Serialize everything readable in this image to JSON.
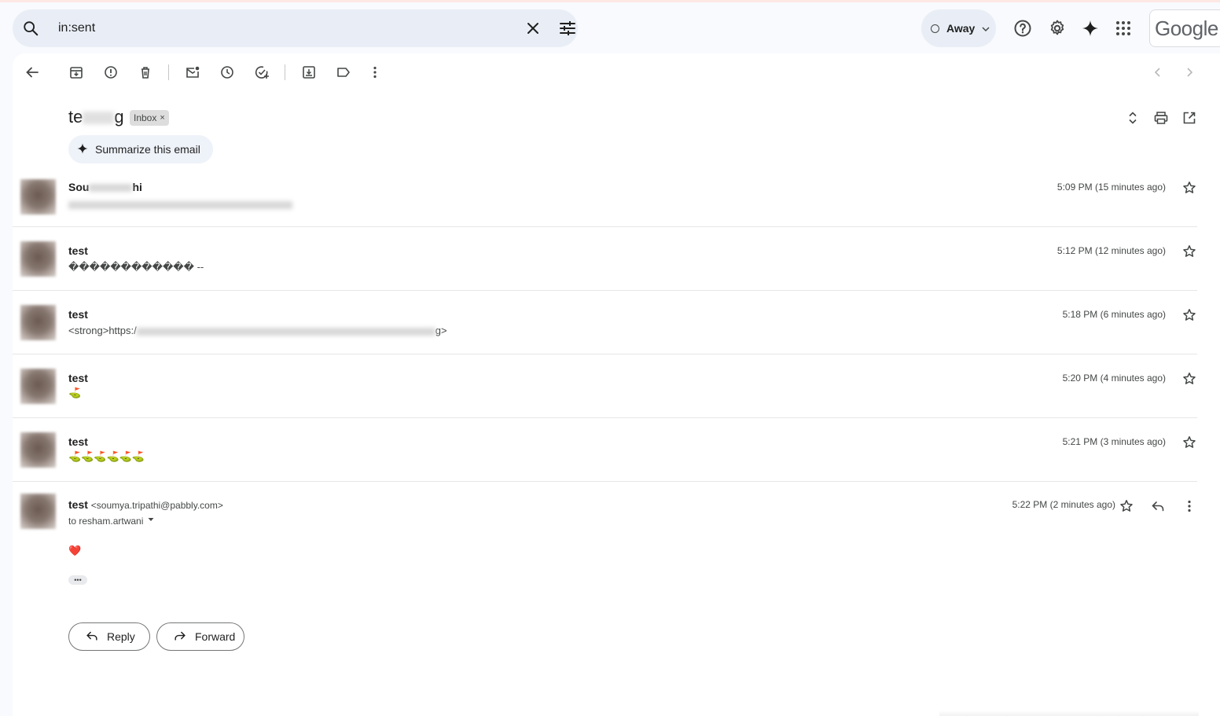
{
  "search": {
    "query": "in:sent"
  },
  "status": {
    "label": "Away"
  },
  "brand": {
    "logo_text": "Google"
  },
  "email": {
    "subject_start": "te",
    "subject_end": "g",
    "label_chip": "Inbox",
    "chip_close": "×",
    "summarize_label": "Summarize this email"
  },
  "thread": [
    {
      "sender_visible_start": "Sou",
      "sender_visible_end": "hi",
      "snippet": "",
      "time": "5:09 PM (15 minutes ago)"
    },
    {
      "sender": "test",
      "snippet": "������������ --",
      "time": "5:12 PM (12 minutes ago)"
    },
    {
      "sender": "test",
      "snippet_start": "<strong>https:/",
      "snippet_end": "g>",
      "time": "5:18 PM (6 minutes ago)"
    },
    {
      "sender": "test",
      "snippet": "⛳",
      "time": "5:20 PM (4 minutes ago)"
    },
    {
      "sender": "test",
      "snippet": "⛳⛳⛳⛳⛳⛳",
      "time": "5:21 PM (3 minutes ago)"
    }
  ],
  "expanded": {
    "sender": "test",
    "sender_email": "<soumya.tripathi@pabbly.com>",
    "to": "to resham.artwani",
    "time": "5:22 PM (2 minutes ago)",
    "body": "❤️",
    "ellipsis": "•••"
  },
  "actions": {
    "reply_label": "Reply",
    "forward_label": "Forward"
  },
  "colors": {
    "accent_bg": "#e9eef6",
    "panel": "#ffffff",
    "page": "#f8fafd",
    "heart": "#e53935"
  }
}
